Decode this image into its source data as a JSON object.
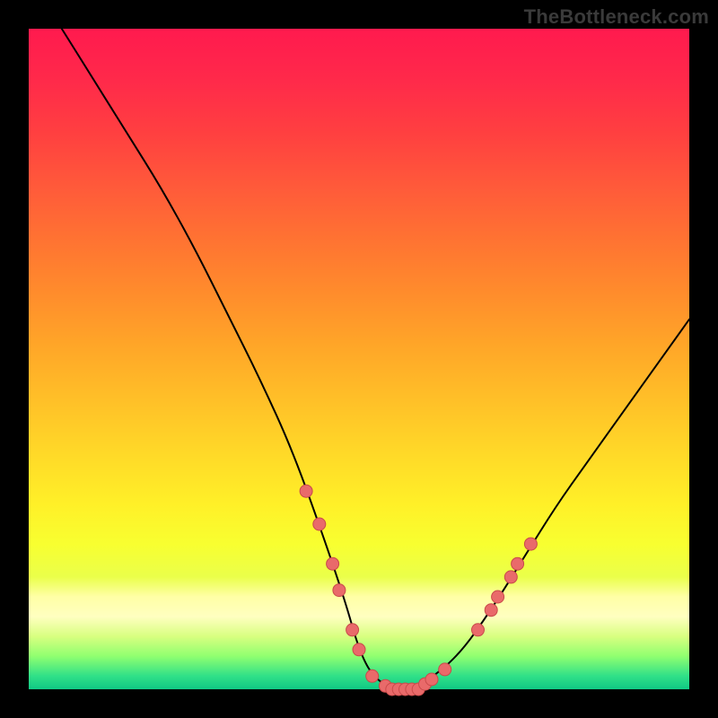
{
  "watermark": "TheBottleneck.com",
  "chart_data": {
    "type": "line",
    "title": "",
    "xlabel": "",
    "ylabel": "",
    "xlim": [
      0,
      100
    ],
    "ylim": [
      0,
      100
    ],
    "x": [
      0,
      5,
      10,
      15,
      20,
      25,
      30,
      35,
      40,
      45,
      48,
      50,
      52,
      55,
      58,
      60,
      65,
      70,
      75,
      80,
      85,
      90,
      95,
      100
    ],
    "values": [
      108,
      100,
      92,
      84,
      76,
      67,
      57,
      47,
      36,
      22,
      13,
      6,
      2,
      0,
      0,
      1,
      5,
      12,
      20,
      28,
      35,
      42,
      49,
      56
    ],
    "annotations": {
      "dots_approx": [
        {
          "x": 42,
          "y": 30
        },
        {
          "x": 44,
          "y": 25
        },
        {
          "x": 46,
          "y": 19
        },
        {
          "x": 47,
          "y": 15
        },
        {
          "x": 49,
          "y": 9
        },
        {
          "x": 50,
          "y": 6
        },
        {
          "x": 52,
          "y": 2
        },
        {
          "x": 54,
          "y": 0.5
        },
        {
          "x": 55,
          "y": 0
        },
        {
          "x": 56,
          "y": 0
        },
        {
          "x": 57,
          "y": 0
        },
        {
          "x": 58,
          "y": 0
        },
        {
          "x": 59,
          "y": 0
        },
        {
          "x": 60,
          "y": 0.8
        },
        {
          "x": 61,
          "y": 1.5
        },
        {
          "x": 63,
          "y": 3
        },
        {
          "x": 68,
          "y": 9
        },
        {
          "x": 70,
          "y": 12
        },
        {
          "x": 71,
          "y": 14
        },
        {
          "x": 73,
          "y": 17
        },
        {
          "x": 74,
          "y": 19
        },
        {
          "x": 76,
          "y": 22
        }
      ]
    }
  },
  "colors": {
    "curve": "#000000",
    "dot_fill": "#e96a6a",
    "dot_stroke": "#c94a4a"
  }
}
